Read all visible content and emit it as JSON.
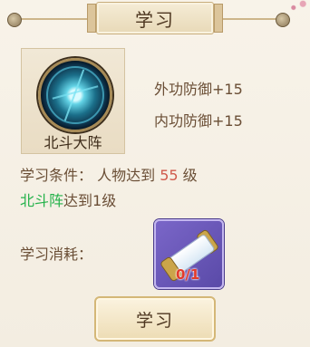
{
  "header": {
    "title": "学习"
  },
  "skill": {
    "name": "北斗大阵",
    "icon": "skill-orb-icon"
  },
  "stats": [
    "外功防御+15",
    "内功防御+15"
  ],
  "requirement": {
    "label": "学习条件：",
    "text": "人物达到",
    "level": "55",
    "suffix": "级",
    "extra_highlight": "北斗阵",
    "extra_text": "达到1级"
  },
  "cost": {
    "label": "学习消耗：",
    "item_icon": "scroll-icon",
    "count": "0/1"
  },
  "button": {
    "label": "学习"
  },
  "colors": {
    "level": "#d05a4c",
    "highlight": "#24b24a",
    "count": "#e33b2b"
  }
}
